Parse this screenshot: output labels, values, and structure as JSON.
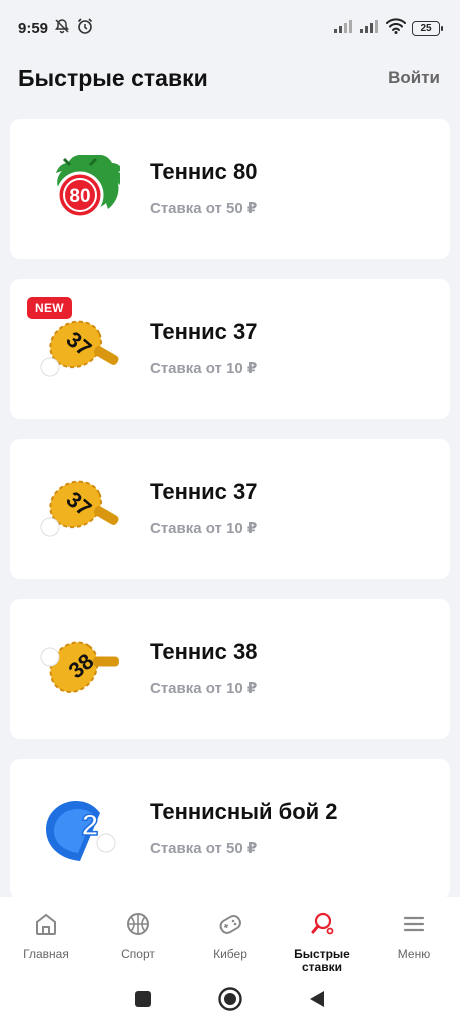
{
  "status_bar": {
    "time": "9:59",
    "battery": "25"
  },
  "header": {
    "title": "Быстрые ставки",
    "login": "Войти"
  },
  "cards": [
    {
      "title": "Теннис 80",
      "subtitle": "Ставка от 50 ₽",
      "icon": "tennis-80-dragon-icon",
      "icon_text": "80",
      "badge": ""
    },
    {
      "title": "Теннис 37",
      "subtitle": "Ставка от 10 ₽",
      "icon": "tennis-racket-icon",
      "icon_text": "37",
      "badge": "NEW"
    },
    {
      "title": "Теннис 37",
      "subtitle": "Ставка от 10 ₽",
      "icon": "tennis-racket-icon",
      "icon_text": "37",
      "badge": ""
    },
    {
      "title": "Теннис 38",
      "subtitle": "Ставка от 10 ₽",
      "icon": "tennis-racket-icon",
      "icon_text": "38",
      "badge": ""
    },
    {
      "title": "Теннисный бой 2",
      "subtitle": "Ставка от 50 ₽",
      "icon": "tennis-battle-icon",
      "icon_text": "2",
      "badge": ""
    }
  ],
  "bottom_nav": [
    {
      "label": "Главная",
      "icon": "home-icon"
    },
    {
      "label": "Спорт",
      "icon": "basketball-icon"
    },
    {
      "label": "Кибер",
      "icon": "gamepad-icon"
    },
    {
      "label": "Быстрые ставки",
      "icon": "ping-pong-icon",
      "active": true
    },
    {
      "label": "Меню",
      "icon": "hamburger-icon"
    }
  ],
  "colors": {
    "accent": "#e8202e",
    "background": "#f2f3f7",
    "racket": "#f0b21f",
    "dragon_green": "#2e9a3a",
    "battle_blue": "#1f6fe0"
  }
}
